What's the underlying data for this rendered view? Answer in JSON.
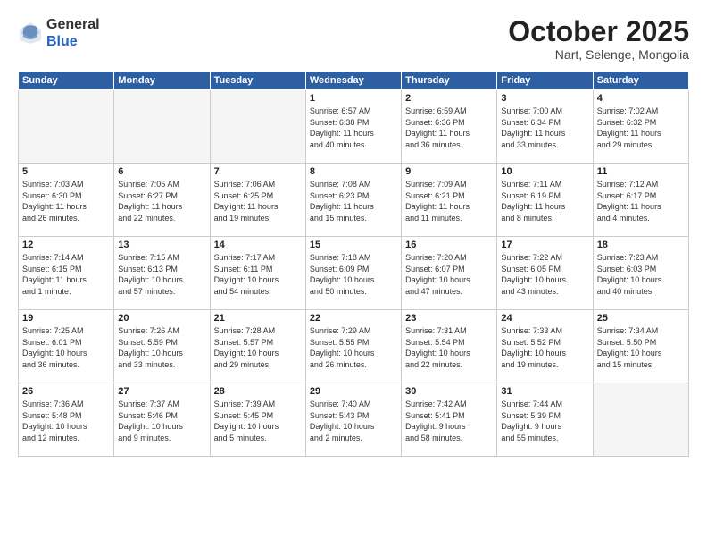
{
  "header": {
    "logo_general": "General",
    "logo_blue": "Blue",
    "month": "October 2025",
    "location": "Nart, Selenge, Mongolia"
  },
  "days_of_week": [
    "Sunday",
    "Monday",
    "Tuesday",
    "Wednesday",
    "Thursday",
    "Friday",
    "Saturday"
  ],
  "weeks": [
    [
      {
        "day": "",
        "text": ""
      },
      {
        "day": "",
        "text": ""
      },
      {
        "day": "",
        "text": ""
      },
      {
        "day": "1",
        "text": "Sunrise: 6:57 AM\nSunset: 6:38 PM\nDaylight: 11 hours\nand 40 minutes."
      },
      {
        "day": "2",
        "text": "Sunrise: 6:59 AM\nSunset: 6:36 PM\nDaylight: 11 hours\nand 36 minutes."
      },
      {
        "day": "3",
        "text": "Sunrise: 7:00 AM\nSunset: 6:34 PM\nDaylight: 11 hours\nand 33 minutes."
      },
      {
        "day": "4",
        "text": "Sunrise: 7:02 AM\nSunset: 6:32 PM\nDaylight: 11 hours\nand 29 minutes."
      }
    ],
    [
      {
        "day": "5",
        "text": "Sunrise: 7:03 AM\nSunset: 6:30 PM\nDaylight: 11 hours\nand 26 minutes."
      },
      {
        "day": "6",
        "text": "Sunrise: 7:05 AM\nSunset: 6:27 PM\nDaylight: 11 hours\nand 22 minutes."
      },
      {
        "day": "7",
        "text": "Sunrise: 7:06 AM\nSunset: 6:25 PM\nDaylight: 11 hours\nand 19 minutes."
      },
      {
        "day": "8",
        "text": "Sunrise: 7:08 AM\nSunset: 6:23 PM\nDaylight: 11 hours\nand 15 minutes."
      },
      {
        "day": "9",
        "text": "Sunrise: 7:09 AM\nSunset: 6:21 PM\nDaylight: 11 hours\nand 11 minutes."
      },
      {
        "day": "10",
        "text": "Sunrise: 7:11 AM\nSunset: 6:19 PM\nDaylight: 11 hours\nand 8 minutes."
      },
      {
        "day": "11",
        "text": "Sunrise: 7:12 AM\nSunset: 6:17 PM\nDaylight: 11 hours\nand 4 minutes."
      }
    ],
    [
      {
        "day": "12",
        "text": "Sunrise: 7:14 AM\nSunset: 6:15 PM\nDaylight: 11 hours\nand 1 minute."
      },
      {
        "day": "13",
        "text": "Sunrise: 7:15 AM\nSunset: 6:13 PM\nDaylight: 10 hours\nand 57 minutes."
      },
      {
        "day": "14",
        "text": "Sunrise: 7:17 AM\nSunset: 6:11 PM\nDaylight: 10 hours\nand 54 minutes."
      },
      {
        "day": "15",
        "text": "Sunrise: 7:18 AM\nSunset: 6:09 PM\nDaylight: 10 hours\nand 50 minutes."
      },
      {
        "day": "16",
        "text": "Sunrise: 7:20 AM\nSunset: 6:07 PM\nDaylight: 10 hours\nand 47 minutes."
      },
      {
        "day": "17",
        "text": "Sunrise: 7:22 AM\nSunset: 6:05 PM\nDaylight: 10 hours\nand 43 minutes."
      },
      {
        "day": "18",
        "text": "Sunrise: 7:23 AM\nSunset: 6:03 PM\nDaylight: 10 hours\nand 40 minutes."
      }
    ],
    [
      {
        "day": "19",
        "text": "Sunrise: 7:25 AM\nSunset: 6:01 PM\nDaylight: 10 hours\nand 36 minutes."
      },
      {
        "day": "20",
        "text": "Sunrise: 7:26 AM\nSunset: 5:59 PM\nDaylight: 10 hours\nand 33 minutes."
      },
      {
        "day": "21",
        "text": "Sunrise: 7:28 AM\nSunset: 5:57 PM\nDaylight: 10 hours\nand 29 minutes."
      },
      {
        "day": "22",
        "text": "Sunrise: 7:29 AM\nSunset: 5:55 PM\nDaylight: 10 hours\nand 26 minutes."
      },
      {
        "day": "23",
        "text": "Sunrise: 7:31 AM\nSunset: 5:54 PM\nDaylight: 10 hours\nand 22 minutes."
      },
      {
        "day": "24",
        "text": "Sunrise: 7:33 AM\nSunset: 5:52 PM\nDaylight: 10 hours\nand 19 minutes."
      },
      {
        "day": "25",
        "text": "Sunrise: 7:34 AM\nSunset: 5:50 PM\nDaylight: 10 hours\nand 15 minutes."
      }
    ],
    [
      {
        "day": "26",
        "text": "Sunrise: 7:36 AM\nSunset: 5:48 PM\nDaylight: 10 hours\nand 12 minutes."
      },
      {
        "day": "27",
        "text": "Sunrise: 7:37 AM\nSunset: 5:46 PM\nDaylight: 10 hours\nand 9 minutes."
      },
      {
        "day": "28",
        "text": "Sunrise: 7:39 AM\nSunset: 5:45 PM\nDaylight: 10 hours\nand 5 minutes."
      },
      {
        "day": "29",
        "text": "Sunrise: 7:40 AM\nSunset: 5:43 PM\nDaylight: 10 hours\nand 2 minutes."
      },
      {
        "day": "30",
        "text": "Sunrise: 7:42 AM\nSunset: 5:41 PM\nDaylight: 9 hours\nand 58 minutes."
      },
      {
        "day": "31",
        "text": "Sunrise: 7:44 AM\nSunset: 5:39 PM\nDaylight: 9 hours\nand 55 minutes."
      },
      {
        "day": "",
        "text": ""
      }
    ]
  ]
}
